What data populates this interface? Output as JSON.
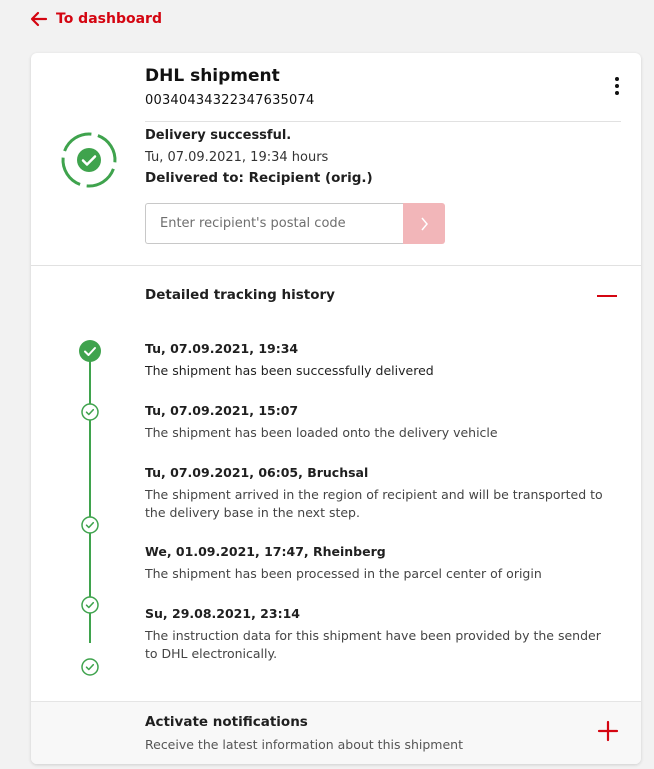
{
  "nav": {
    "back_label": "To dashboard"
  },
  "shipment": {
    "title": "DHL shipment",
    "tracking_number": "00340434322347635074"
  },
  "status": {
    "title": "Delivery successful.",
    "time": "Tu, 07.09.2021, 19:34 hours",
    "delivered_to": "Delivered to:  Recipient (orig.)",
    "postal_placeholder": "Enter recipient's postal code"
  },
  "history": {
    "heading": "Detailed tracking history",
    "events": [
      {
        "date": "Tu, 07.09.2021, 19:34",
        "description": "The shipment has been successfully delivered"
      },
      {
        "date": "Tu, 07.09.2021, 15:07",
        "description": "The shipment has been loaded onto the delivery vehicle"
      },
      {
        "date": "Tu, 07.09.2021, 06:05, Bruchsal",
        "description": "The shipment arrived in the region of recipient and will be transported to the delivery base in the next step."
      },
      {
        "date": "We, 01.09.2021, 17:47, Rheinberg",
        "description": "The shipment has been processed in the parcel center of origin"
      },
      {
        "date": "Su, 29.08.2021, 23:14",
        "description": "The instruction data for this shipment have been provided by the sender to DHL electronically."
      }
    ]
  },
  "notifications": {
    "title": "Activate notifications",
    "subtitle": "Receive the latest information about this shipment"
  },
  "colors": {
    "brand_red": "#d40511",
    "success_green": "#3fa34d",
    "submit_disabled": "#f2b6b9"
  },
  "icons": [
    "arrow-left-icon",
    "more-vertical-icon",
    "check-circle-icon",
    "chevron-right-icon",
    "minus-icon",
    "check-icon",
    "plus-icon"
  ]
}
